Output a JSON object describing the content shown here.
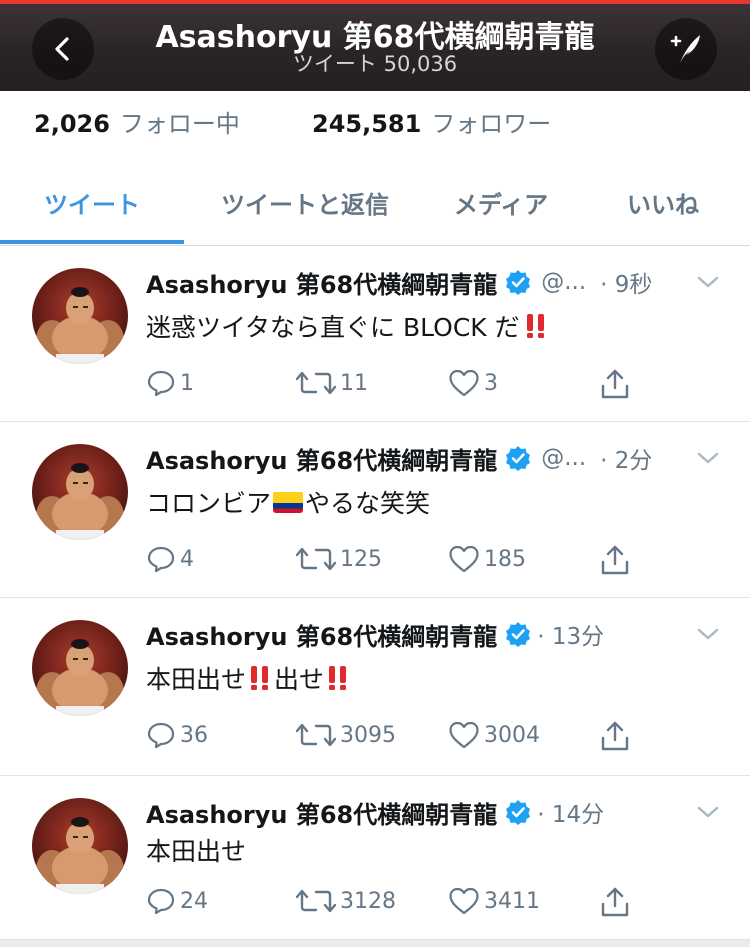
{
  "header": {
    "title": "Asashoryu 第68代横綱朝青龍",
    "subtitle": "ツイート 50,036"
  },
  "stats": {
    "following_count": "2,026",
    "following_label": "フォロー中",
    "followers_count": "245,581",
    "followers_label": "フォロワー"
  },
  "tabs": [
    {
      "label": "ツイート",
      "active": true
    },
    {
      "label": "ツイートと返信",
      "active": false
    },
    {
      "label": "メディア",
      "active": false
    },
    {
      "label": "いいね",
      "active": false
    }
  ],
  "tweets": [
    {
      "name": "Asashoryu 第68代横綱朝青龍",
      "handle": "@...",
      "time": "· 9秒",
      "text": "迷惑ツイタなら直ぐに BLOCK だ",
      "text_after": "",
      "replies": "1",
      "retweets": "11",
      "likes": "3"
    },
    {
      "name": "Asashoryu 第68代横綱朝青龍",
      "handle": "@...",
      "time": "· 2分",
      "text": "コロンビア",
      "text_after": "やるな笑笑",
      "replies": "4",
      "retweets": "125",
      "likes": "185"
    },
    {
      "name": "Asashoryu 第68代横綱朝青龍",
      "handle": "",
      "time": "· 13分",
      "text": "本田出せ",
      "text_after": "出せ",
      "replies": "36",
      "retweets": "3095",
      "likes": "3004"
    },
    {
      "name": "Asashoryu 第68代横綱朝青龍",
      "handle": "",
      "time": "· 14分",
      "text": "本田出せ",
      "text_after": "",
      "replies": "24",
      "retweets": "3128",
      "likes": "3411"
    }
  ],
  "icons": {
    "back": "chevron-left-icon",
    "compose": "compose-tweet-icon",
    "verified": "verified-badge-icon",
    "reply": "reply-icon",
    "retweet": "retweet-icon",
    "like": "heart-icon",
    "share": "share-icon",
    "caret": "chevron-down-icon"
  },
  "colors": {
    "accent": "#3d94e0",
    "header_bg": "#2a2428",
    "muted": "#657786",
    "exclaim": "#e0282e",
    "verified": "#1da1f2"
  }
}
